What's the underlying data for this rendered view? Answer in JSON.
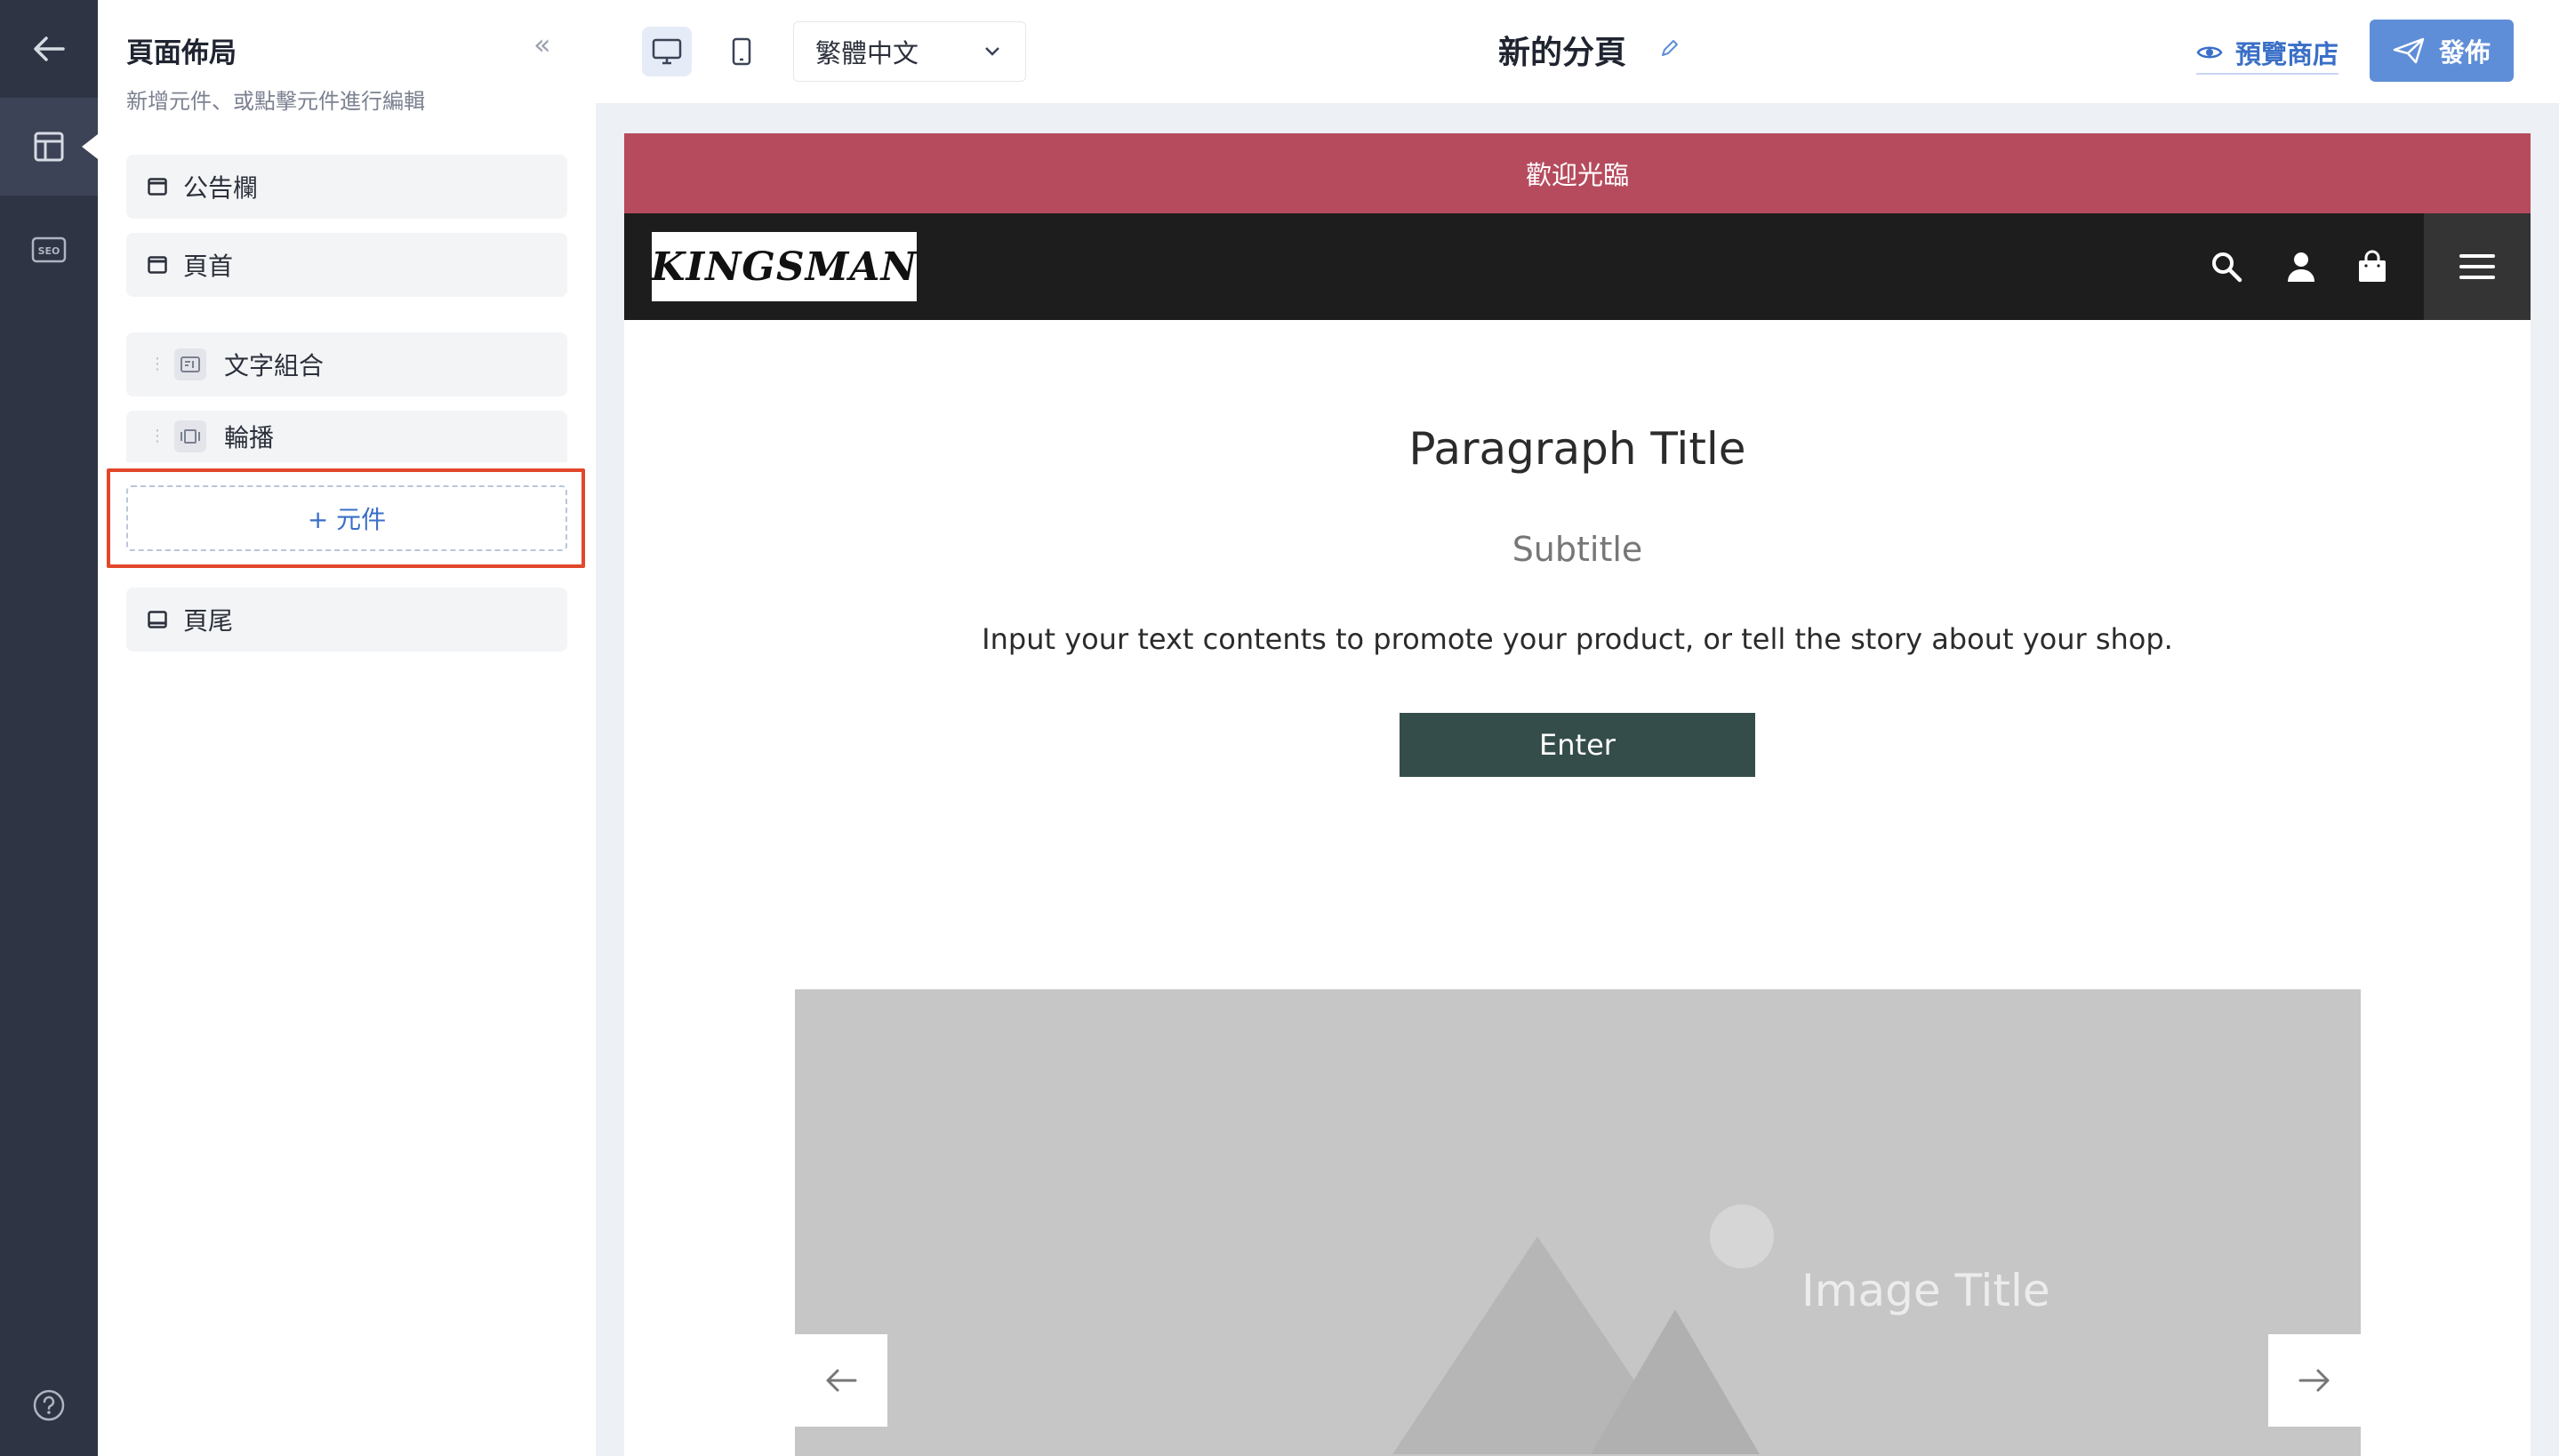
{
  "rail": {
    "items": [
      {
        "name": "back",
        "icon": "arrow-left-icon"
      },
      {
        "name": "layout",
        "icon": "layout-icon",
        "active": true
      },
      {
        "name": "seo",
        "icon": "seo-icon",
        "label": "SEO"
      },
      {
        "name": "help",
        "icon": "help-circle-icon"
      }
    ]
  },
  "sidebar": {
    "title": "頁面佈局",
    "subtitle": "新增元件、或點擊元件進行編輯",
    "collapse_icon": "double-chevron-left-icon",
    "collapse_glyph": "«",
    "fixed_top": [
      {
        "label": "公告欄",
        "icon": "window-icon"
      },
      {
        "label": "頁首",
        "icon": "window-icon"
      }
    ],
    "components": [
      {
        "label": "文字組合",
        "icon": "text-block-icon"
      },
      {
        "label": "輪播",
        "icon": "carousel-icon"
      }
    ],
    "add_button": "+ 元件",
    "fixed_bottom": [
      {
        "label": "頁尾",
        "icon": "footer-icon"
      }
    ]
  },
  "topbar": {
    "device": {
      "desktop_icon": "desktop-icon",
      "mobile_icon": "mobile-icon",
      "selected": "desktop"
    },
    "language": {
      "value": "繁體中文",
      "icon": "chevron-down-icon"
    },
    "page_title": "新的分頁",
    "rename_icon": "pencil-icon",
    "preview_label": "預覽商店",
    "preview_icon": "eye-icon",
    "publish_label": "發佈",
    "publish_icon": "paper-plane-icon"
  },
  "preview_site": {
    "announcement": "歡迎光臨",
    "announcement_color": "#b64b5e",
    "logo_text": "KINGSMAN",
    "nav_icons": [
      "search-icon",
      "user-icon",
      "shopping-bag-icon",
      "menu-icon"
    ],
    "text_block": {
      "title": "Paragraph Title",
      "subtitle": "Subtitle",
      "body": "Input your text contents to promote your product, or tell the story about your shop.",
      "button": "Enter",
      "button_color": "#354d4a"
    },
    "carousel": {
      "image_title": "Image Title",
      "prev_icon": "arrow-left-icon",
      "next_icon": "arrow-right-icon"
    }
  },
  "colors": {
    "rail": "#2f3444",
    "accent": "#5f8ed8",
    "highlight": "#e2472a"
  }
}
